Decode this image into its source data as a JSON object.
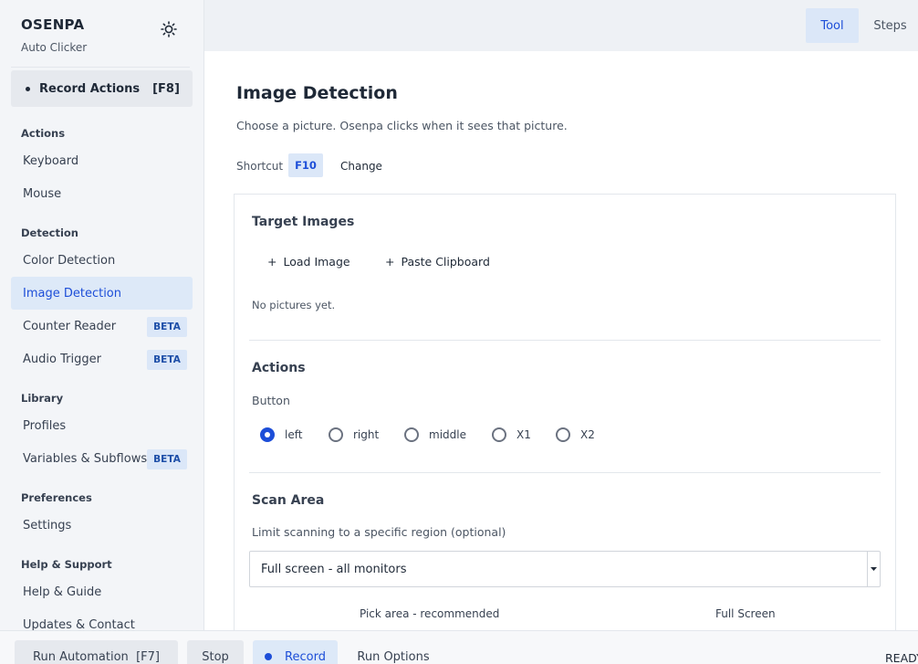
{
  "app": {
    "name": "OSENPA",
    "subtitle": "Auto Clicker"
  },
  "sidebar": {
    "record": {
      "label": "Record Actions",
      "key": "[F8]"
    },
    "sections": {
      "actions": "Actions",
      "detection": "Detection",
      "library": "Library",
      "preferences": "Preferences",
      "help": "Help & Support"
    },
    "items": {
      "keyboard": "Keyboard",
      "mouse": "Mouse",
      "color_detection": "Color Detection",
      "image_detection": "Image Detection",
      "counter_reader": "Counter Reader",
      "audio_trigger": "Audio Trigger",
      "profiles": "Profiles",
      "variables": "Variables & Subflows",
      "settings": "Settings",
      "help_guide": "Help & Guide",
      "updates": "Updates & Contact"
    },
    "beta_label": "BETA",
    "active": "image_detection"
  },
  "topbar": {
    "tabs": [
      "Tool",
      "Steps"
    ],
    "active_tab": "Tool"
  },
  "main": {
    "title": "Image Detection",
    "description": "Choose a picture. Osenpa clicks when it sees that picture.",
    "shortcut": {
      "label": "Shortcut",
      "key": "F10",
      "change": "Change"
    },
    "target_images": {
      "title": "Target Images",
      "load": "Load Image",
      "paste": "Paste Clipboard",
      "empty": "No pictures yet."
    },
    "actions": {
      "title": "Actions",
      "button_label": "Button",
      "options": [
        "left",
        "right",
        "middle",
        "X1",
        "X2"
      ],
      "selected": "left"
    },
    "scan_area": {
      "title": "Scan Area",
      "hint": "Limit scanning to a specific region (optional)",
      "selected": "Full screen - all monitors",
      "pick_area": "Pick area - recommended",
      "full_screen": "Full Screen"
    }
  },
  "bottombar": {
    "run": "Run Automation",
    "run_key": "[F7]",
    "stop": "Stop",
    "record": "Record",
    "run_options": "Run Options",
    "status": "READY"
  },
  "colors": {
    "accent": "#1d4ed8",
    "accent_bg": "#dbe7f8",
    "sidebar_bg": "#f3f5f8"
  }
}
